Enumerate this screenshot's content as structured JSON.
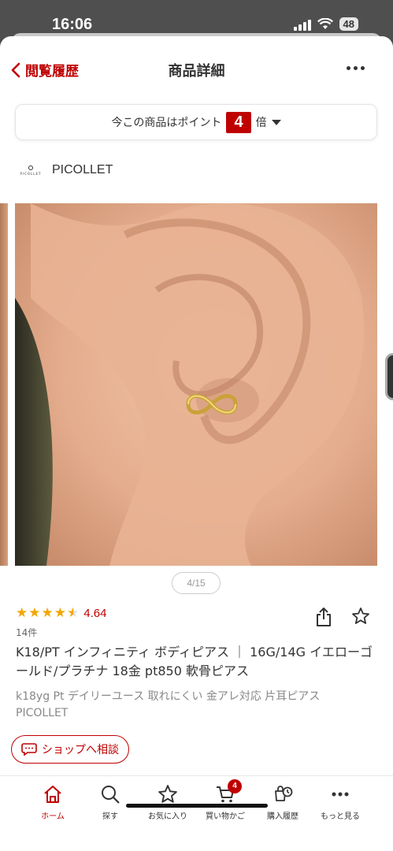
{
  "status": {
    "time": "16:06",
    "battery": "48"
  },
  "nav": {
    "back_label": "閲覧履歴",
    "title": "商品詳細"
  },
  "points": {
    "prefix": "今この商品はポイント",
    "multiplier": "4",
    "suffix": "倍"
  },
  "shop": {
    "logo_text": "PICOLLET",
    "name": "PICOLLET"
  },
  "gallery": {
    "pager": "4/15",
    "current_index": 4,
    "total": 15
  },
  "product": {
    "rating_value": "4.64",
    "rating_stars": 4.64,
    "review_count": "14件",
    "title": "K18/PT インフィニティ ボディピアス ｜ 16G/14G イエローゴールド/プラチナ 18金 pt850 軟骨ピアス",
    "subtitle": "k18yg Pt デイリーユース 取れにくい 金アレ対応 片耳ピアス PICOLLET"
  },
  "consult": {
    "label": "ショップへ相談"
  },
  "tabs": [
    {
      "label": "ホーム",
      "icon": "home-icon",
      "active": true
    },
    {
      "label": "探す",
      "icon": "search-icon",
      "active": false
    },
    {
      "label": "お気に入り",
      "icon": "star-icon",
      "active": false
    },
    {
      "label": "買い物かご",
      "icon": "cart-icon",
      "active": false,
      "badge": "4"
    },
    {
      "label": "購入履歴",
      "icon": "purchase-history-icon",
      "active": false
    },
    {
      "label": "もっと見る",
      "icon": "more-icon",
      "active": false
    }
  ],
  "colors": {
    "accent": "#bf0000",
    "star": "#f2a600"
  }
}
